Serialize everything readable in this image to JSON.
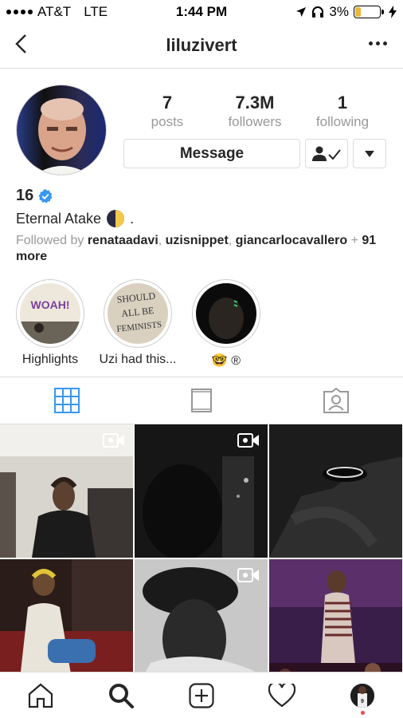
{
  "status_bar": {
    "carrier": "AT&T",
    "network": "LTE",
    "time": "1:44 PM",
    "battery_percent": "3%",
    "battery_level": 0.03
  },
  "nav": {
    "title": "liluzivert",
    "back_icon": "chevron-left-icon",
    "more_icon": "more-horizontal-icon"
  },
  "profile": {
    "stats": [
      {
        "value": "7",
        "label": "posts"
      },
      {
        "value": "7.3M",
        "label": "followers"
      },
      {
        "value": "1",
        "label": "following"
      }
    ],
    "message_label": "Message",
    "name": "16",
    "bio": "Eternal Atake",
    "bio_suffix": ".",
    "followed_by_prefix": "Followed by",
    "followed_users": [
      "renataadavi",
      "uzisnippet",
      "giancarlocavallero"
    ],
    "followed_more": "91 more",
    "verified_color": "#3897f0"
  },
  "highlights": [
    {
      "label": "Highlights",
      "cover_text": "WOAH!"
    },
    {
      "label": "Uzi had this...",
      "cover_text": "SHOULD ALL BE FEMINISTS"
    },
    {
      "label": "🤓 ®",
      "cover_text": ""
    }
  ],
  "tabs": [
    {
      "name": "grid",
      "icon": "grid-icon",
      "active": true
    },
    {
      "name": "igtv",
      "icon": "igtv-icon",
      "active": false
    },
    {
      "name": "tagged",
      "icon": "tagged-icon",
      "active": false
    }
  ],
  "posts": [
    {
      "type": "video"
    },
    {
      "type": "video"
    },
    {
      "type": "photo"
    },
    {
      "type": "photo"
    },
    {
      "type": "video"
    },
    {
      "type": "photo"
    }
  ],
  "bottom_nav": [
    "home-icon",
    "search-icon",
    "add-post-icon",
    "activity-icon",
    "profile-icon"
  ],
  "colors": {
    "accent": "#3897f0",
    "notification_dot": "#ed4956"
  }
}
